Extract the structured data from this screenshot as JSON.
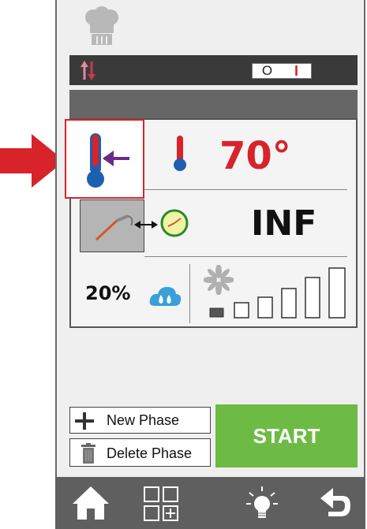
{
  "header": {
    "power_switch": {
      "off_label": "O",
      "on_label": "I"
    }
  },
  "settings": {
    "temperature": "70°",
    "time": "INF",
    "humidity": "20%",
    "fan_speed_level": 1,
    "fan_speed_levels": 6
  },
  "actions": {
    "new_phase_label": "New Phase",
    "delete_phase_label": "Delete Phase",
    "start_label": "START"
  },
  "colors": {
    "accent_red": "#d8232a",
    "start_green": "#6dbb45",
    "dark_bar": "#3a3a3a",
    "nav_bg": "#5f5f5f"
  },
  "icons": [
    "chef-hat-icon",
    "heat-arrows-icon",
    "thermometer-setpoint-icon",
    "thermometer-icon",
    "core-probe-icon",
    "clock-icon",
    "humidity-drop-icon",
    "fan-icon",
    "plus-icon",
    "trash-icon",
    "home-icon",
    "grid-add-icon",
    "light-bulb-icon",
    "back-icon"
  ]
}
